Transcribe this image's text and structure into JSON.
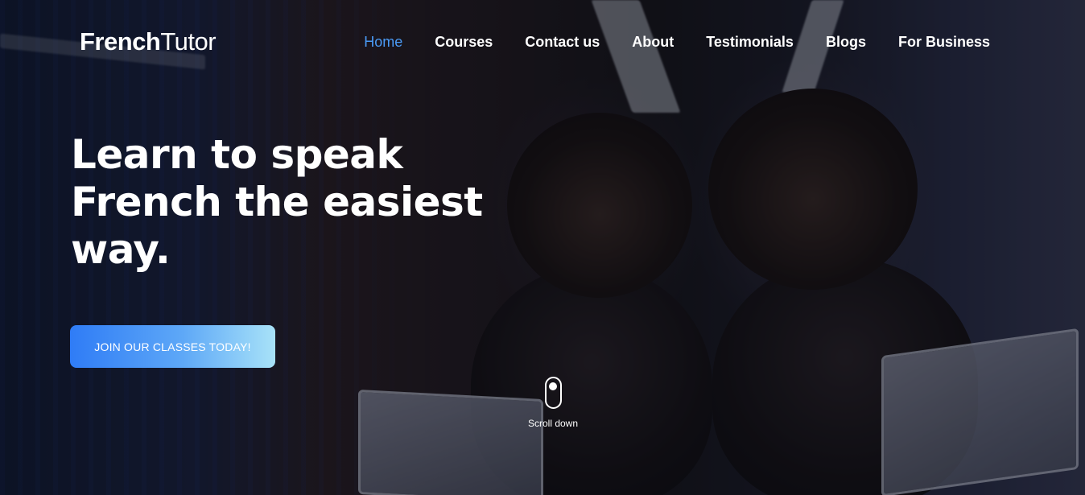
{
  "brand": {
    "name_bold": "French",
    "name_light": "Tutor"
  },
  "nav": {
    "items": [
      {
        "label": "Home",
        "active": true
      },
      {
        "label": "Courses",
        "active": false
      },
      {
        "label": "Contact us",
        "active": false
      },
      {
        "label": "About",
        "active": false
      },
      {
        "label": "Testimonials",
        "active": false
      },
      {
        "label": "Blogs",
        "active": false
      },
      {
        "label": "For Business",
        "active": false
      }
    ]
  },
  "hero": {
    "title_line1": "Learn to speak",
    "title_line2": "French the easiest",
    "title_line3": "way.",
    "cta_label": "JOIN OUR CLASSES TODAY!",
    "scroll_label": "Scroll down",
    "background_image": "woman-with-laptop-reflection-photo"
  },
  "colors": {
    "accent": "#4a9af5",
    "cta_gradient_start": "#2f7cf6",
    "cta_gradient_end": "#a8e2f8",
    "text": "#ffffff"
  }
}
